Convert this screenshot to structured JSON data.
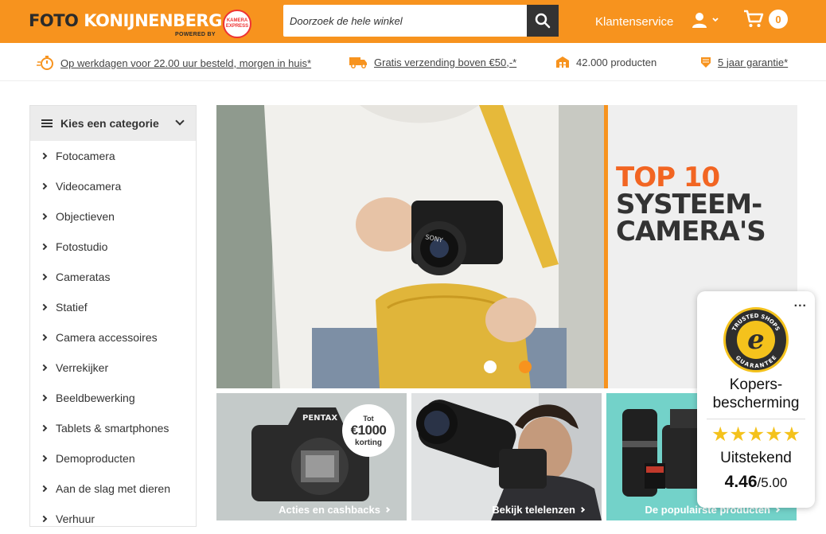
{
  "brand": {
    "logo_left": "FOTO",
    "logo_right": "KONIJNENBERG",
    "powered_by": "POWERED BY",
    "badge_text": "KAMERA EXPRESS",
    "primary_color": "#f7931e",
    "dark_color": "#333333"
  },
  "header": {
    "search_placeholder": "Doorzoek de hele winkel",
    "search_icon": "search-icon",
    "customer_service": "Klantenservice",
    "account_icon": "user-icon",
    "cart_icon": "cart-icon",
    "cart_count": "0"
  },
  "usps": [
    {
      "icon": "stopwatch-icon",
      "text": "Op werkdagen voor 22.00 uur besteld, morgen in huis*",
      "link": true
    },
    {
      "icon": "truck-icon",
      "text": "Gratis verzending boven €50,-*",
      "link": true
    },
    {
      "icon": "warehouse-icon",
      "text": "42.000 producten",
      "link": false
    },
    {
      "icon": "shield-icon",
      "text": "5 jaar garantie*",
      "link": true
    }
  ],
  "sidebar": {
    "header": "Kies een categorie",
    "items": [
      {
        "label": "Fotocamera"
      },
      {
        "label": "Videocamera"
      },
      {
        "label": "Objectieven"
      },
      {
        "label": "Fotostudio"
      },
      {
        "label": "Cameratas"
      },
      {
        "label": "Statief"
      },
      {
        "label": "Camera accessoires"
      },
      {
        "label": "Verrekijker"
      },
      {
        "label": "Beeldbewerking"
      },
      {
        "label": "Tablets & smartphones"
      },
      {
        "label": "Demoproducten"
      },
      {
        "label": "Aan de slag met dieren"
      },
      {
        "label": "Verhuur"
      }
    ]
  },
  "hero": {
    "line1": "TOP 10",
    "line2": "SYSTEEM-",
    "line3": "CAMERA'S",
    "camera_brand": "SONY",
    "slides": 2,
    "active_slide": 2
  },
  "tiles": [
    {
      "label": "Acties en cashbacks",
      "promo_small": "Tot",
      "promo_amount": "€1000",
      "promo_text": "korting",
      "camera_brand": "PENTAX"
    },
    {
      "label": "Bekijk telelenzen"
    },
    {
      "label": "De populairste producten"
    }
  ],
  "trusted_shops": {
    "seal_top": "TRUSTED SHOPS",
    "seal_bottom": "GUARANTEE",
    "seal_letter": "e",
    "title": "Kopers-bescherming",
    "stars": "★★★★★",
    "rating": 4.46,
    "verdict": "Uitstekend",
    "score": "4.46",
    "max": "/5.00",
    "star_color": "#f4c21c",
    "menu": "..."
  }
}
